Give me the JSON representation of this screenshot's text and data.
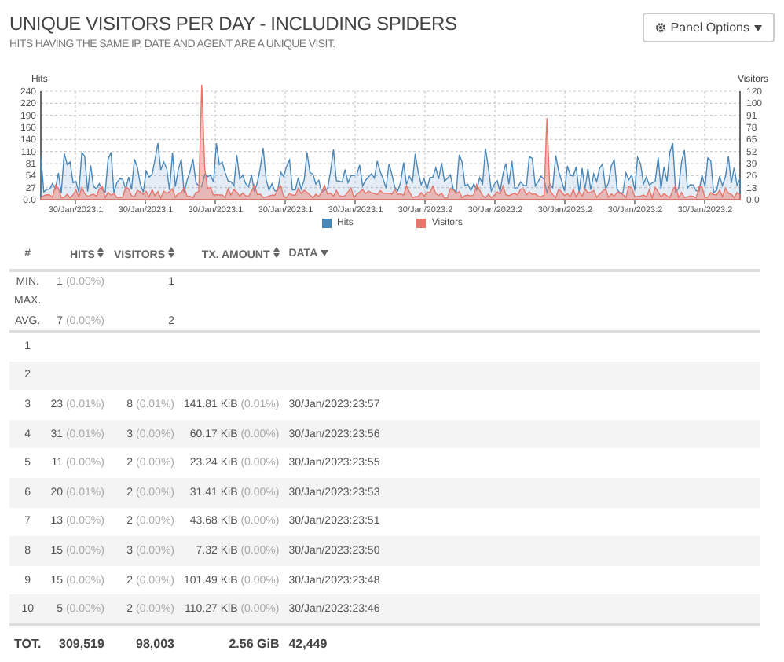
{
  "panel": {
    "title": "UNIQUE VISITORS PER DAY - INCLUDING SPIDERS",
    "subtitle": "HITS HAVING THE SAME IP, DATE AND AGENT ARE A UNIQUE VISIT.",
    "options_button": "Panel Options"
  },
  "chart": {
    "left_axis_title": "Hits",
    "right_axis_title": "Visitors",
    "left_ticks": [
      "240",
      "220",
      "190",
      "160",
      "140",
      "110",
      "81",
      "54",
      "27",
      "0.0"
    ],
    "right_ticks": [
      "120",
      "100",
      "91",
      "78",
      "65",
      "52",
      "39",
      "26",
      "13",
      "0.0"
    ],
    "x_labels": [
      "30/Jan/2023:1",
      "30/Jan/2023:1",
      "30/Jan/2023:1",
      "30/Jan/2023:1",
      "30/Jan/2023:1",
      "30/Jan/2023:2",
      "30/Jan/2023:2",
      "30/Jan/2023:2",
      "30/Jan/2023:2",
      "30/Jan/2023:2"
    ],
    "legend": [
      {
        "label": "Hits",
        "color": "#4a87b9"
      },
      {
        "label": "Visitors",
        "color": "#e8756b"
      }
    ]
  },
  "table": {
    "columns": [
      {
        "label": "#"
      },
      {
        "label": "HITS",
        "sorted": false
      },
      {
        "label": "VISITORS",
        "sorted": false
      },
      {
        "label": "TX. AMOUNT",
        "sorted": false
      },
      {
        "label": "DATA",
        "sorted": true
      }
    ],
    "summary": [
      {
        "label": "MIN.",
        "hits": "1",
        "hits_pct": "(0.00%)",
        "visitors": "1"
      },
      {
        "label": "MAX."
      },
      {
        "label": "AVG.",
        "hits": "7",
        "hits_pct": "(0.00%)",
        "visitors": "2"
      }
    ],
    "rows": [
      {
        "num": "1"
      },
      {
        "num": "2"
      },
      {
        "num": "3",
        "hits": "23",
        "hits_pct": "(0.01%)",
        "visitors": "8",
        "visitors_pct": "(0.01%)",
        "tx": "141.81 KiB",
        "tx_pct": "(0.01%)",
        "data": "30/Jan/2023:23:57"
      },
      {
        "num": "4",
        "hits": "31",
        "hits_pct": "(0.01%)",
        "visitors": "3",
        "visitors_pct": "(0.00%)",
        "tx": "60.17 KiB",
        "tx_pct": "(0.00%)",
        "data": "30/Jan/2023:23:56"
      },
      {
        "num": "5",
        "hits": "11",
        "hits_pct": "(0.00%)",
        "visitors": "2",
        "visitors_pct": "(0.00%)",
        "tx": "23.24 KiB",
        "tx_pct": "(0.00%)",
        "data": "30/Jan/2023:23:55"
      },
      {
        "num": "6",
        "hits": "20",
        "hits_pct": "(0.01%)",
        "visitors": "2",
        "visitors_pct": "(0.00%)",
        "tx": "31.41 KiB",
        "tx_pct": "(0.00%)",
        "data": "30/Jan/2023:23:53"
      },
      {
        "num": "7",
        "hits": "13",
        "hits_pct": "(0.00%)",
        "visitors": "2",
        "visitors_pct": "(0.00%)",
        "tx": "43.68 KiB",
        "tx_pct": "(0.00%)",
        "data": "30/Jan/2023:23:51"
      },
      {
        "num": "8",
        "hits": "15",
        "hits_pct": "(0.00%)",
        "visitors": "3",
        "visitors_pct": "(0.00%)",
        "tx": "7.32 KiB",
        "tx_pct": "(0.00%)",
        "data": "30/Jan/2023:23:50"
      },
      {
        "num": "9",
        "hits": "15",
        "hits_pct": "(0.00%)",
        "visitors": "2",
        "visitors_pct": "(0.00%)",
        "tx": "101.49 KiB",
        "tx_pct": "(0.00%)",
        "data": "30/Jan/2023:23:48"
      },
      {
        "num": "10",
        "hits": "5",
        "hits_pct": "(0.00%)",
        "visitors": "2",
        "visitors_pct": "(0.00%)",
        "tx": "110.27 KiB",
        "tx_pct": "(0.00%)",
        "data": "30/Jan/2023:23:46"
      }
    ],
    "total": {
      "label": "TOT.",
      "hits": "309,519",
      "visitors": "98,003",
      "tx": "2.56 GiB",
      "data": "42,449"
    }
  }
}
